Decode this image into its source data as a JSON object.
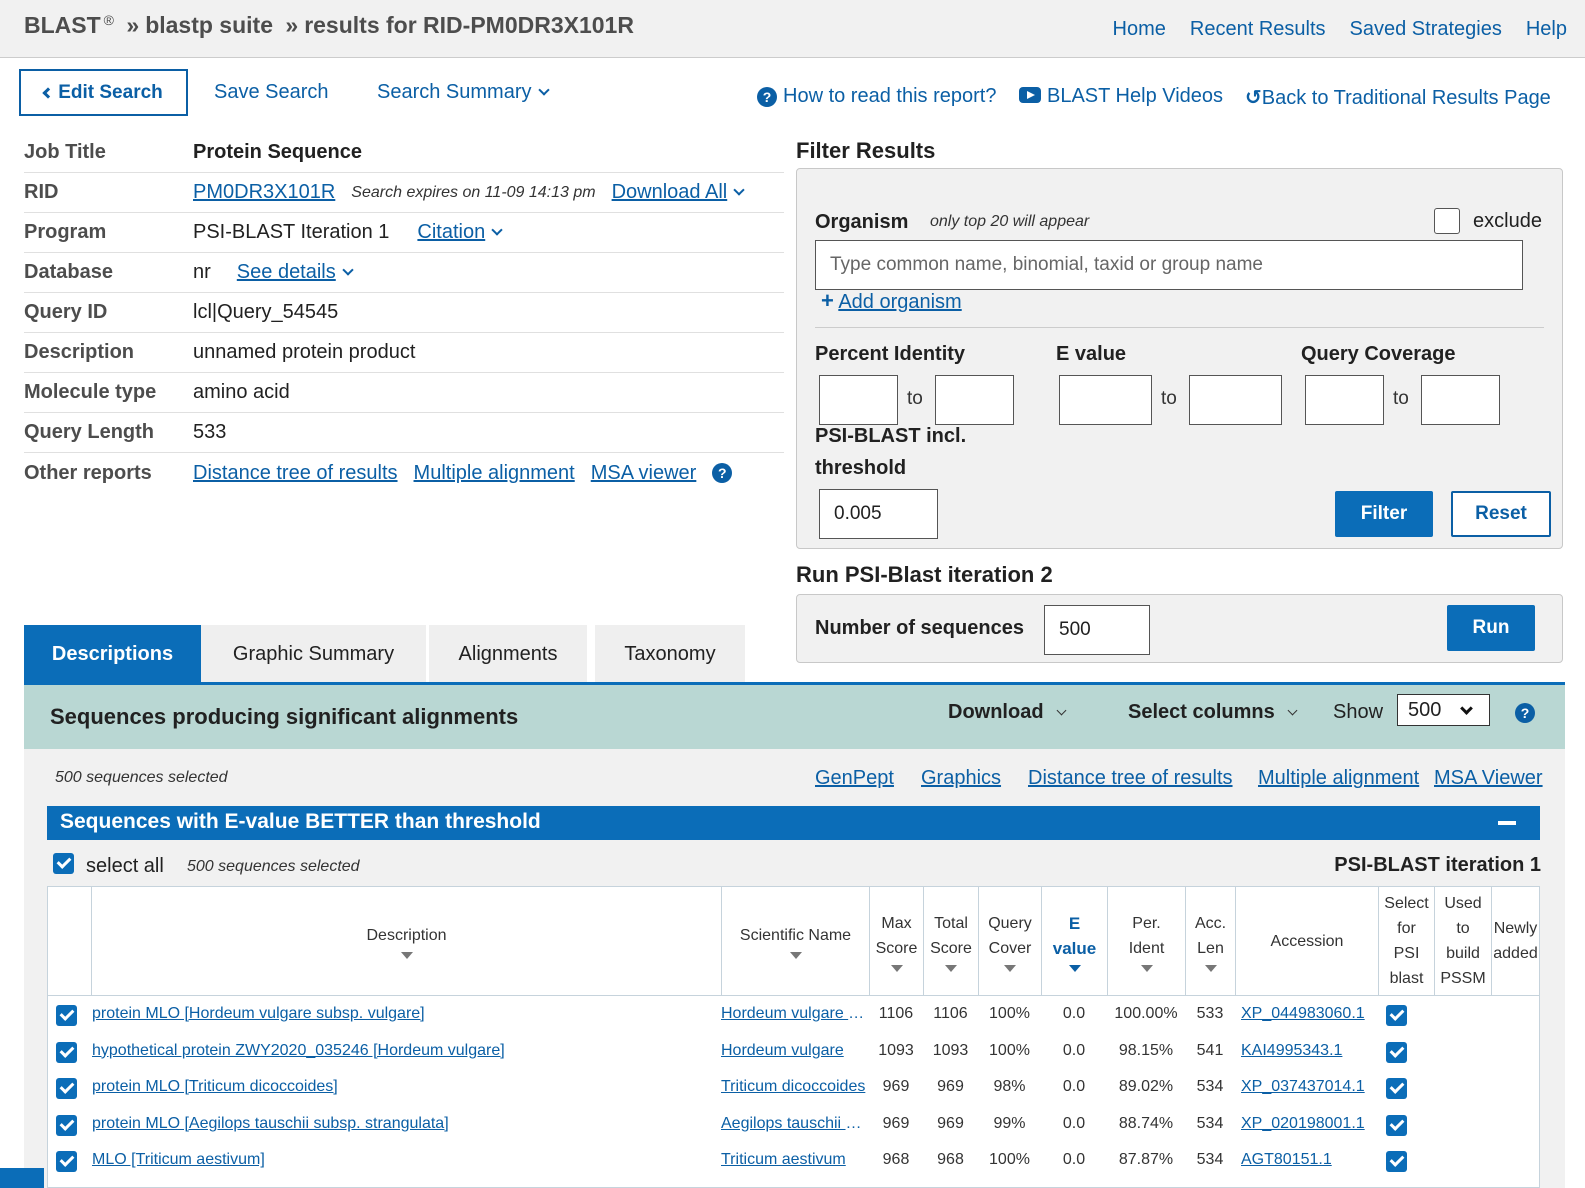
{
  "breadcrumb": {
    "brand": "BLAST",
    "reg": "®",
    "sep1": "»",
    "suite": "blastp suite",
    "sep2": "»",
    "results": "results for RID-PM0DR3X101R"
  },
  "topnav": [
    "Home",
    "Recent Results",
    "Saved Strategies",
    "Help"
  ],
  "actions": {
    "edit_search": "Edit Search",
    "save_search": "Save Search",
    "search_summary": "Search Summary",
    "how_to_read": "How to read this report?",
    "help_videos": "BLAST Help Videos",
    "back_traditional": "Back to Traditional Results Page"
  },
  "info": {
    "job_title_label": "Job Title",
    "job_title": "Protein Sequence",
    "rid_label": "RID",
    "rid": "PM0DR3X101R",
    "expires": "Search expires on 11-09 14:13 pm",
    "download_all": "Download All",
    "program_label": "Program",
    "program": "PSI-BLAST Iteration 1",
    "citation": "Citation",
    "database_label": "Database",
    "database": "nr",
    "see_details": "See details",
    "query_id_label": "Query ID",
    "query_id": "lcl|Query_54545",
    "description_label": "Description",
    "description": "unnamed protein product",
    "molecule_label": "Molecule type",
    "molecule": "amino acid",
    "length_label": "Query Length",
    "length": "533",
    "other_label": "Other reports",
    "other_links": [
      "Distance tree of results",
      "Multiple alignment",
      "MSA viewer"
    ]
  },
  "filter": {
    "title": "Filter Results",
    "organism_label": "Organism",
    "organism_hint": "only top 20 will appear",
    "exclude_label": "exclude",
    "organism_placeholder": "Type common  name, binomial, taxid or group  name",
    "add_organism": "Add organism",
    "percent_identity": "Percent Identity",
    "evalue": "E value",
    "query_coverage": "Query Coverage",
    "to": "to",
    "psi_threshold_1": "PSI-BLAST incl.",
    "psi_threshold_2": "threshold",
    "threshold_value": "0.005",
    "filter_btn": "Filter",
    "reset_btn": "Reset"
  },
  "psi": {
    "title": "Run PSI-Blast iteration 2",
    "num_label": "Number of sequences",
    "num_value": "500",
    "run_btn": "Run"
  },
  "tabs": [
    "Descriptions",
    "Graphic Summary",
    "Alignments",
    "Taxonomy"
  ],
  "results": {
    "title": "Sequences producing significant alignments",
    "download": "Download",
    "select_columns": "Select columns",
    "show": "Show",
    "show_value": "500",
    "selected_count": "500 sequences selected",
    "tool_links": [
      "GenPept",
      "Graphics",
      "Distance tree of results",
      "Multiple alignment",
      "MSA Viewer"
    ],
    "section_title": "Sequences with E-value BETTER than threshold",
    "select_all": "select all",
    "selected_count2": "500 sequences selected",
    "iteration": "PSI-BLAST iteration 1"
  },
  "table": {
    "headers": {
      "description": "Description",
      "scientific": "Scientific Name",
      "max_score": [
        "Max",
        "Score"
      ],
      "total_score": [
        "Total",
        "Score"
      ],
      "query_cover": [
        "Query",
        "Cover"
      ],
      "evalue": [
        "E",
        "value"
      ],
      "per_ident": [
        "Per.",
        "Ident"
      ],
      "acc_len": [
        "Acc.",
        "Len"
      ],
      "accession": "Accession",
      "select_psi": [
        "Select",
        "for",
        "PSI",
        "blast"
      ],
      "used_pssm": [
        "Used",
        "to",
        "build",
        "PSSM"
      ],
      "newly": [
        "Newly",
        "added"
      ]
    },
    "rows": [
      {
        "desc": "protein MLO [Hordeum vulgare subsp. vulgare]",
        "sci": "Hordeum vulgare subsp. vulgare",
        "max": "1106",
        "total": "1106",
        "cover": "100%",
        "e": "0.0",
        "ident": "100.00%",
        "len": "533",
        "acc": "XP_044983060.1"
      },
      {
        "desc": "hypothetical protein ZWY2020_035246 [Hordeum vulgare]",
        "sci": "Hordeum vulgare",
        "max": "1093",
        "total": "1093",
        "cover": "100%",
        "e": "0.0",
        "ident": "98.15%",
        "len": "541",
        "acc": "KAI4995343.1"
      },
      {
        "desc": "protein MLO [Triticum dicoccoides]",
        "sci": "Triticum dicoccoides",
        "max": "969",
        "total": "969",
        "cover": "98%",
        "e": "0.0",
        "ident": "89.02%",
        "len": "534",
        "acc": "XP_037437014.1"
      },
      {
        "desc": "protein MLO [Aegilops tauschii subsp. strangulata]",
        "sci": "Aegilops tauschii subsp. strangulata",
        "max": "969",
        "total": "969",
        "cover": "99%",
        "e": "0.0",
        "ident": "88.74%",
        "len": "534",
        "acc": "XP_020198001.1"
      },
      {
        "desc": "MLO [Triticum aestivum]",
        "sci": "Triticum aestivum",
        "max": "968",
        "total": "968",
        "cover": "100%",
        "e": "0.0",
        "ident": "87.87%",
        "len": "534",
        "acc": "AGT80151.1"
      }
    ]
  },
  "colors": {
    "primary": "#0b6db8",
    "link": "#0b5fa5",
    "header_teal": "#b9d7d3",
    "panel_grey": "#f1f1f1"
  }
}
